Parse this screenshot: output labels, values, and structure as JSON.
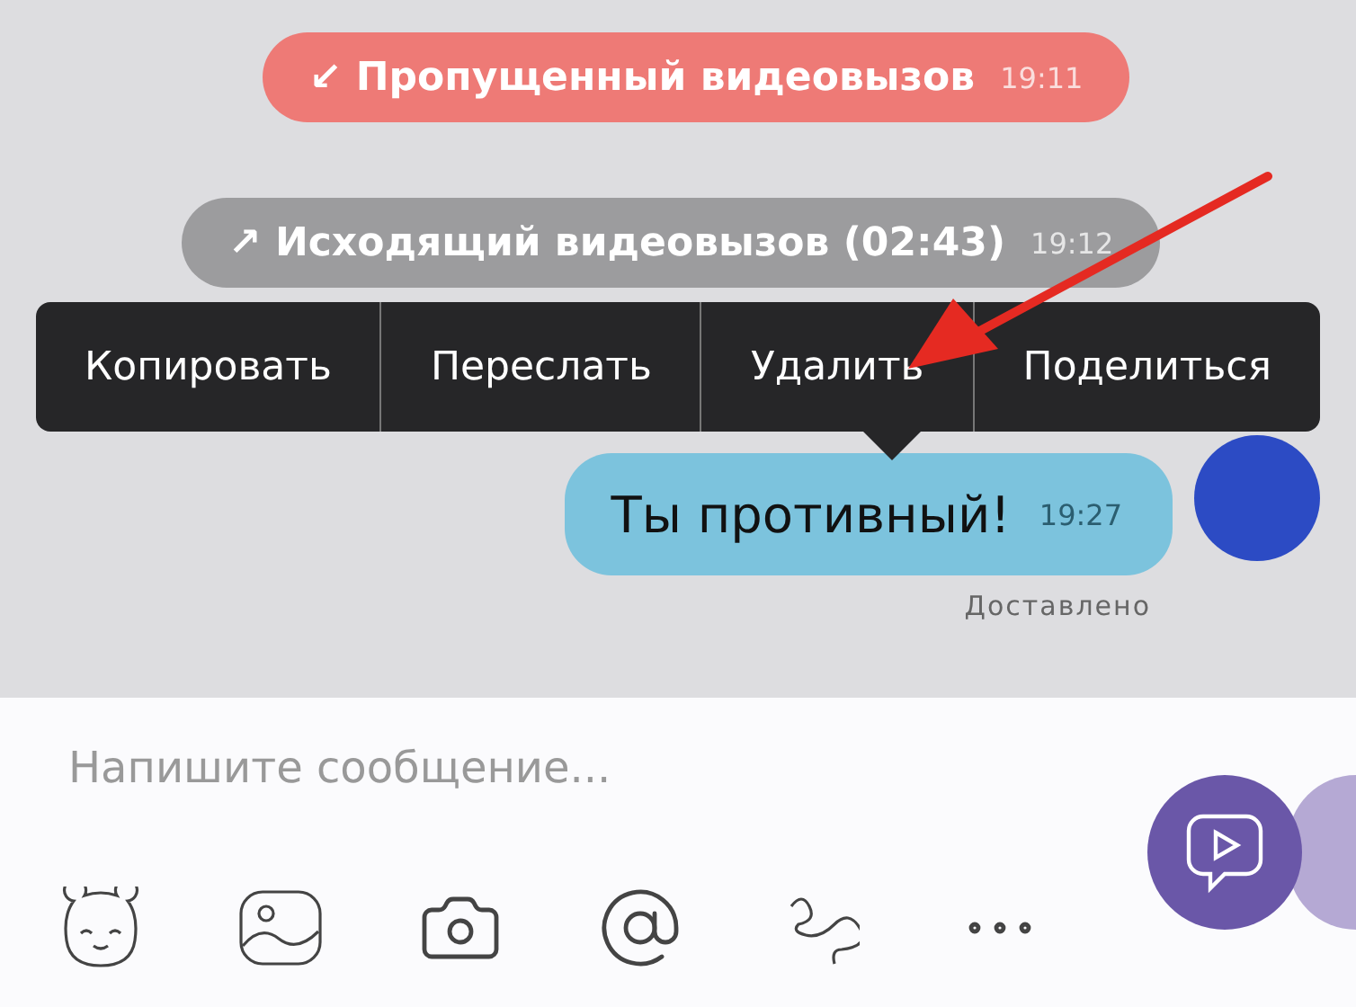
{
  "calls": [
    {
      "kind": "missed",
      "arrow": "↙",
      "label": "Пропущенный видеовызов",
      "time": "19:11"
    },
    {
      "kind": "outgoing",
      "arrow": "↗",
      "label": "Исходящий видеовызов (02:43)",
      "time": "19:12"
    }
  ],
  "context_menu": [
    "Копировать",
    "Переслать",
    "Удалить",
    "Поделиться"
  ],
  "message": {
    "text": "Ты противный!",
    "time": "19:27",
    "status": "Доставлено"
  },
  "composer": {
    "placeholder": "Напишите сообщение..."
  }
}
